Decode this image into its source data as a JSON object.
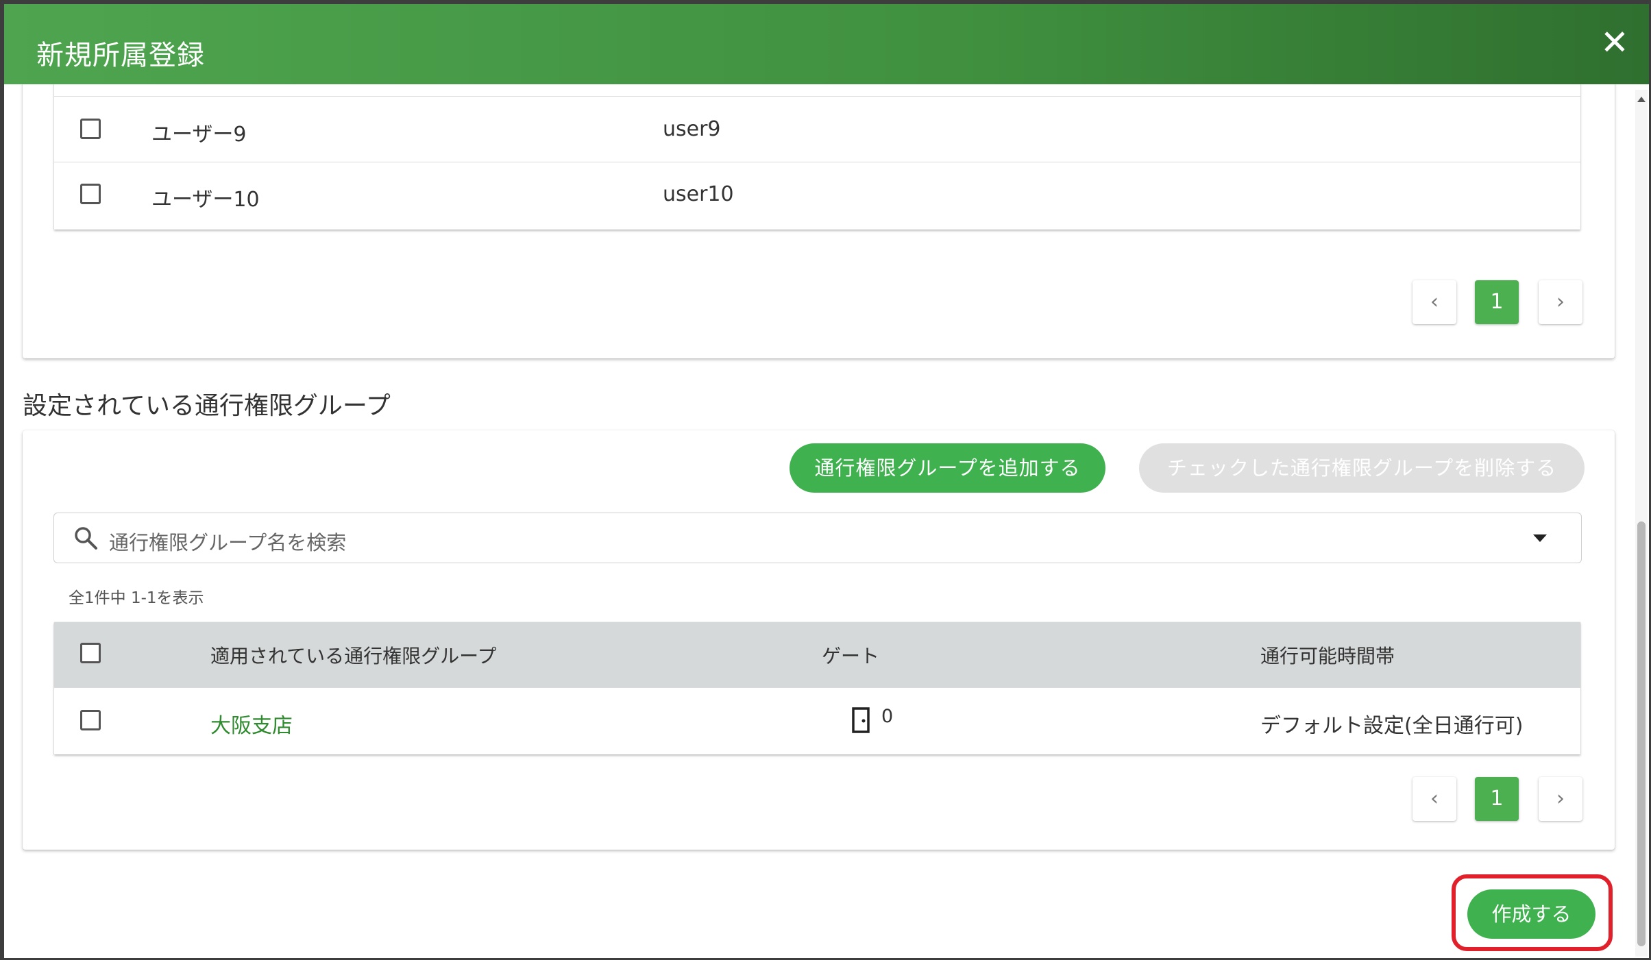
{
  "dialog": {
    "title": "新規所属登録",
    "close_label": "✕"
  },
  "users_table": {
    "rows": [
      {
        "name": "ユーザー9",
        "id": "user9"
      },
      {
        "name": "ユーザー10",
        "id": "user10"
      }
    ],
    "pager": {
      "prev": "‹",
      "page": "1",
      "next": "›"
    }
  },
  "groups_section": {
    "title": "設定されている通行権限グループ",
    "add_button": "通行権限グループを追加する",
    "delete_button": "チェックした通行権限グループを削除する",
    "search_placeholder": "通行権限グループ名を検索",
    "count_text": "全1件中 1-1を表示",
    "columns": [
      "適用されている通行権限グループ",
      "ゲート",
      "通行可能時間帯"
    ],
    "rows": [
      {
        "group": "大阪支店",
        "gate_count": "0",
        "time": "デフォルト設定(全日通行可)"
      }
    ],
    "pager": {
      "prev": "‹",
      "page": "1",
      "next": "›"
    }
  },
  "footer": {
    "create_button": "作成する"
  },
  "colors": {
    "header_green": "#4fa54f",
    "button_green": "#3fb24f",
    "highlight_red": "#e0202a",
    "link_green": "#2e8b2e"
  }
}
